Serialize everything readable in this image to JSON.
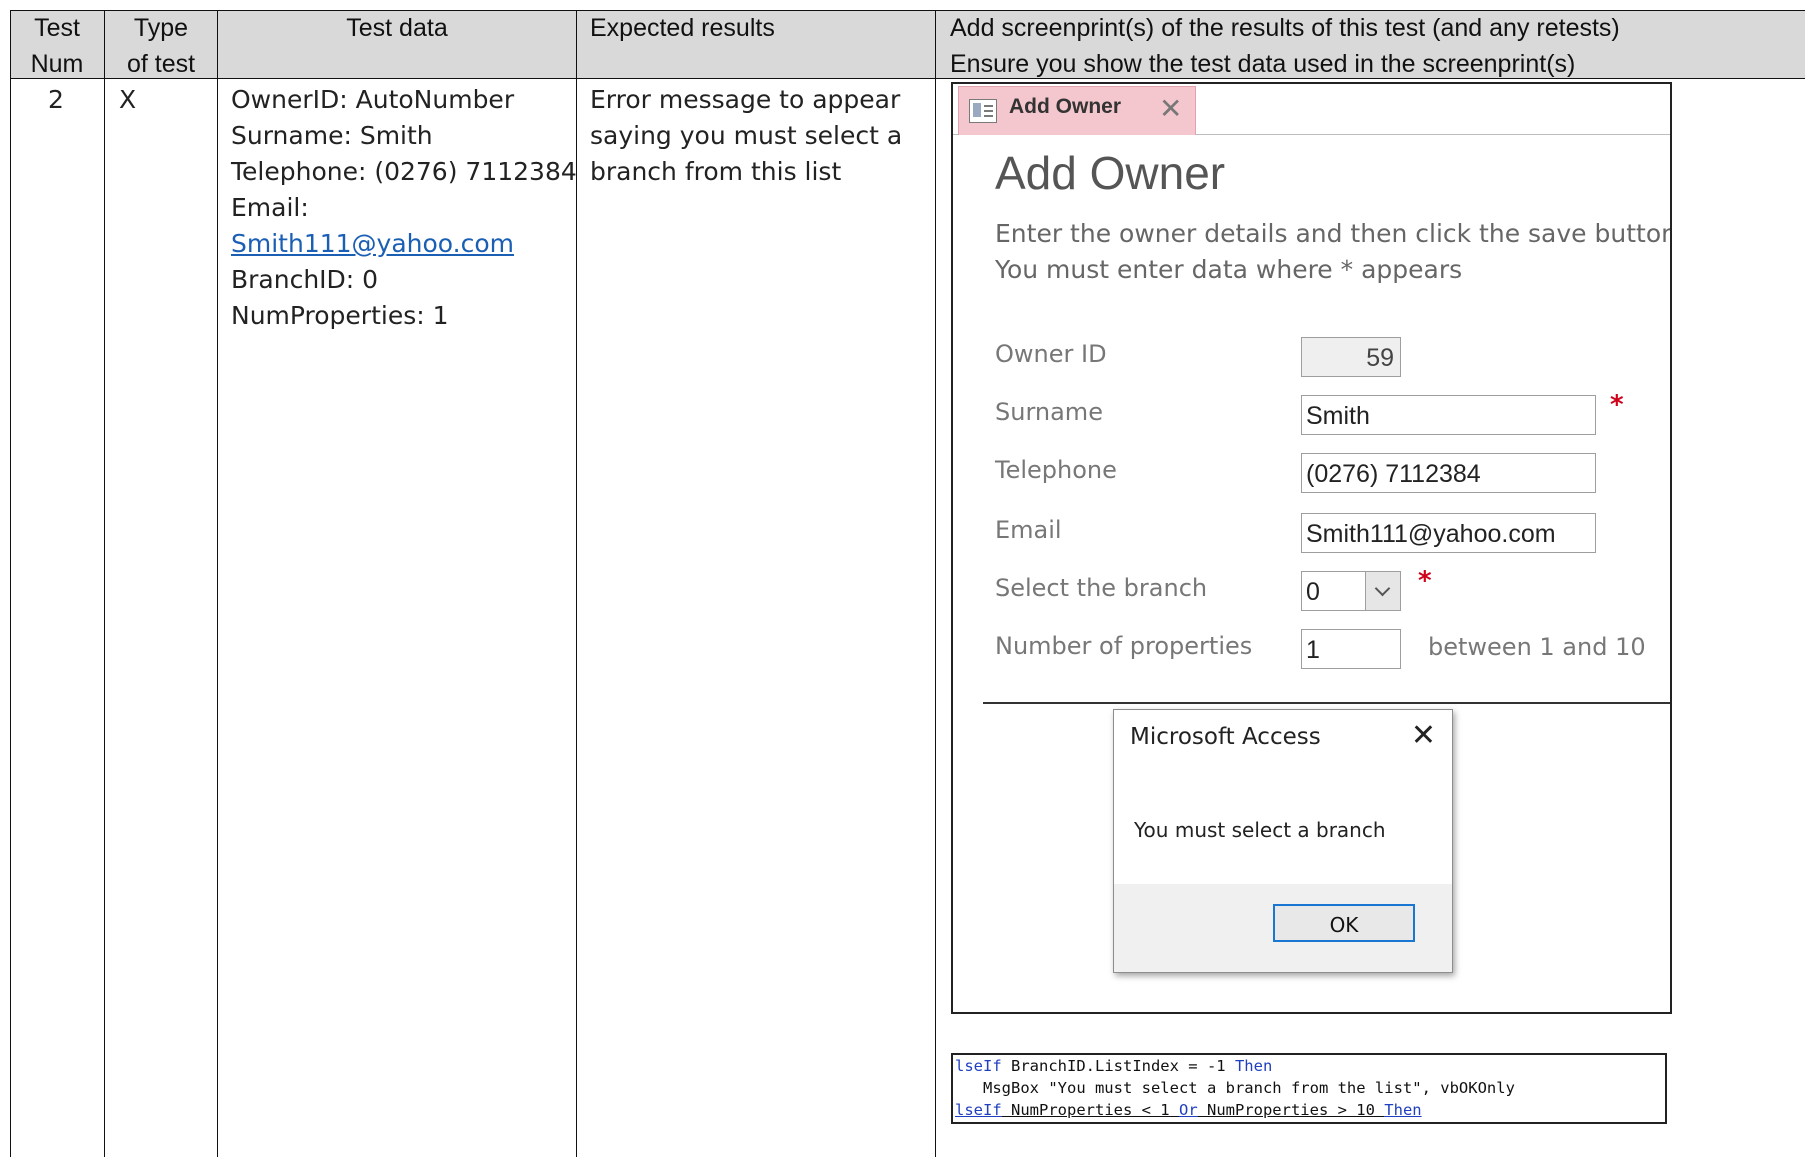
{
  "table": {
    "headers": {
      "test_num": [
        "Test",
        "Num"
      ],
      "type": [
        "Type",
        "of test"
      ],
      "test_data": "Test data",
      "expected": "Expected results",
      "screenprints": [
        "Add screenprint(s) of the results of this test (and any retests)",
        "Ensure you show the test data used in the screenprint(s)"
      ]
    },
    "row": {
      "test_num": "2",
      "type": "X",
      "test_data": {
        "owner_id": "OwnerID: AutoNumber",
        "surname": "Surname: Smith",
        "telephone": "Telephone: (0276) 7112384",
        "email_label": "Email:",
        "email_link": "Smith111@yahoo.com",
        "branch_id": "BranchID: 0",
        "num_properties": "NumProperties: 1"
      },
      "expected": [
        "Error message to appear",
        "saying you must select a",
        "branch from this list"
      ]
    }
  },
  "access_form": {
    "tab_label": "Add Owner",
    "title": "Add Owner",
    "instructions": [
      "Enter the owner details and then click the save button.",
      "You must enter data where * appears"
    ],
    "fields": {
      "owner_id": {
        "label": "Owner ID",
        "value": "59"
      },
      "surname": {
        "label": "Surname",
        "value": "Smith"
      },
      "telephone": {
        "label": "Telephone",
        "value": "(0276) 7112384"
      },
      "email": {
        "label": "Email",
        "value": "Smith111@yahoo.com"
      },
      "branch": {
        "label": "Select the branch",
        "value": "0"
      },
      "num_properties": {
        "label": "Number of properties",
        "value": "1",
        "hint": "between 1 and 10"
      }
    },
    "required_marker": "*"
  },
  "message_box": {
    "title": "Microsoft Access",
    "message": "You must select a branch",
    "ok_label": "OK"
  },
  "code_snippet": {
    "line1_a": "lseIf",
    "line1_b": " BranchID.ListIndex = -1 ",
    "line1_c": "Then",
    "line2": "   MsgBox \"You must select a branch from the list\", vbOKOnly",
    "line3_a": "lseIf",
    "line3_b": " NumProperties < 1 ",
    "line3_c": "Or",
    "line3_d": " NumProperties > 10 ",
    "line3_e": "Then"
  },
  "colors": {
    "header_bg": "#d9d9d9",
    "tab_bg": "#f4c7cf",
    "link": "#1a5fb4",
    "required": "#d0021b",
    "ok_border": "#1976d2"
  }
}
